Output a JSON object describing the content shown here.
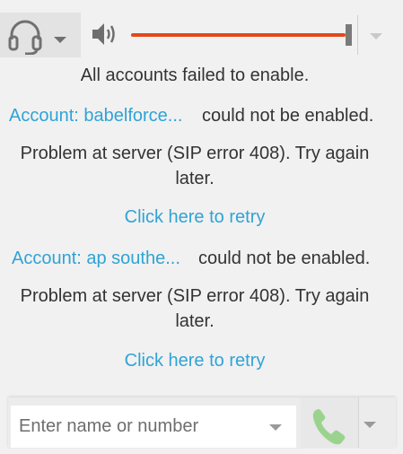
{
  "toolbar": {
    "headset_icon": "headset-icon",
    "speaker_icon": "speaker-icon",
    "volume_level": 1.0
  },
  "status": {
    "title": "All accounts failed to enable."
  },
  "accounts": [
    {
      "link": "Account: babelforce...",
      "status": "could not be enabled.",
      "problem_line1": "Problem at server (SIP error 408). Try again",
      "problem_line2": "later.",
      "retry": "Click here to retry"
    },
    {
      "link": "Account: ap southe...",
      "status": "could not be enabled.",
      "problem_line1": "Problem at server (SIP error 408). Try again",
      "problem_line2": "later.",
      "retry": "Click here to retry"
    }
  ],
  "dialbar": {
    "placeholder": "Enter name or number",
    "value": "",
    "call_icon": "phone-icon"
  },
  "colors": {
    "link": "#2fa3d6",
    "volume_track": "#e24a1a",
    "call_icon": "#9bd38e"
  }
}
